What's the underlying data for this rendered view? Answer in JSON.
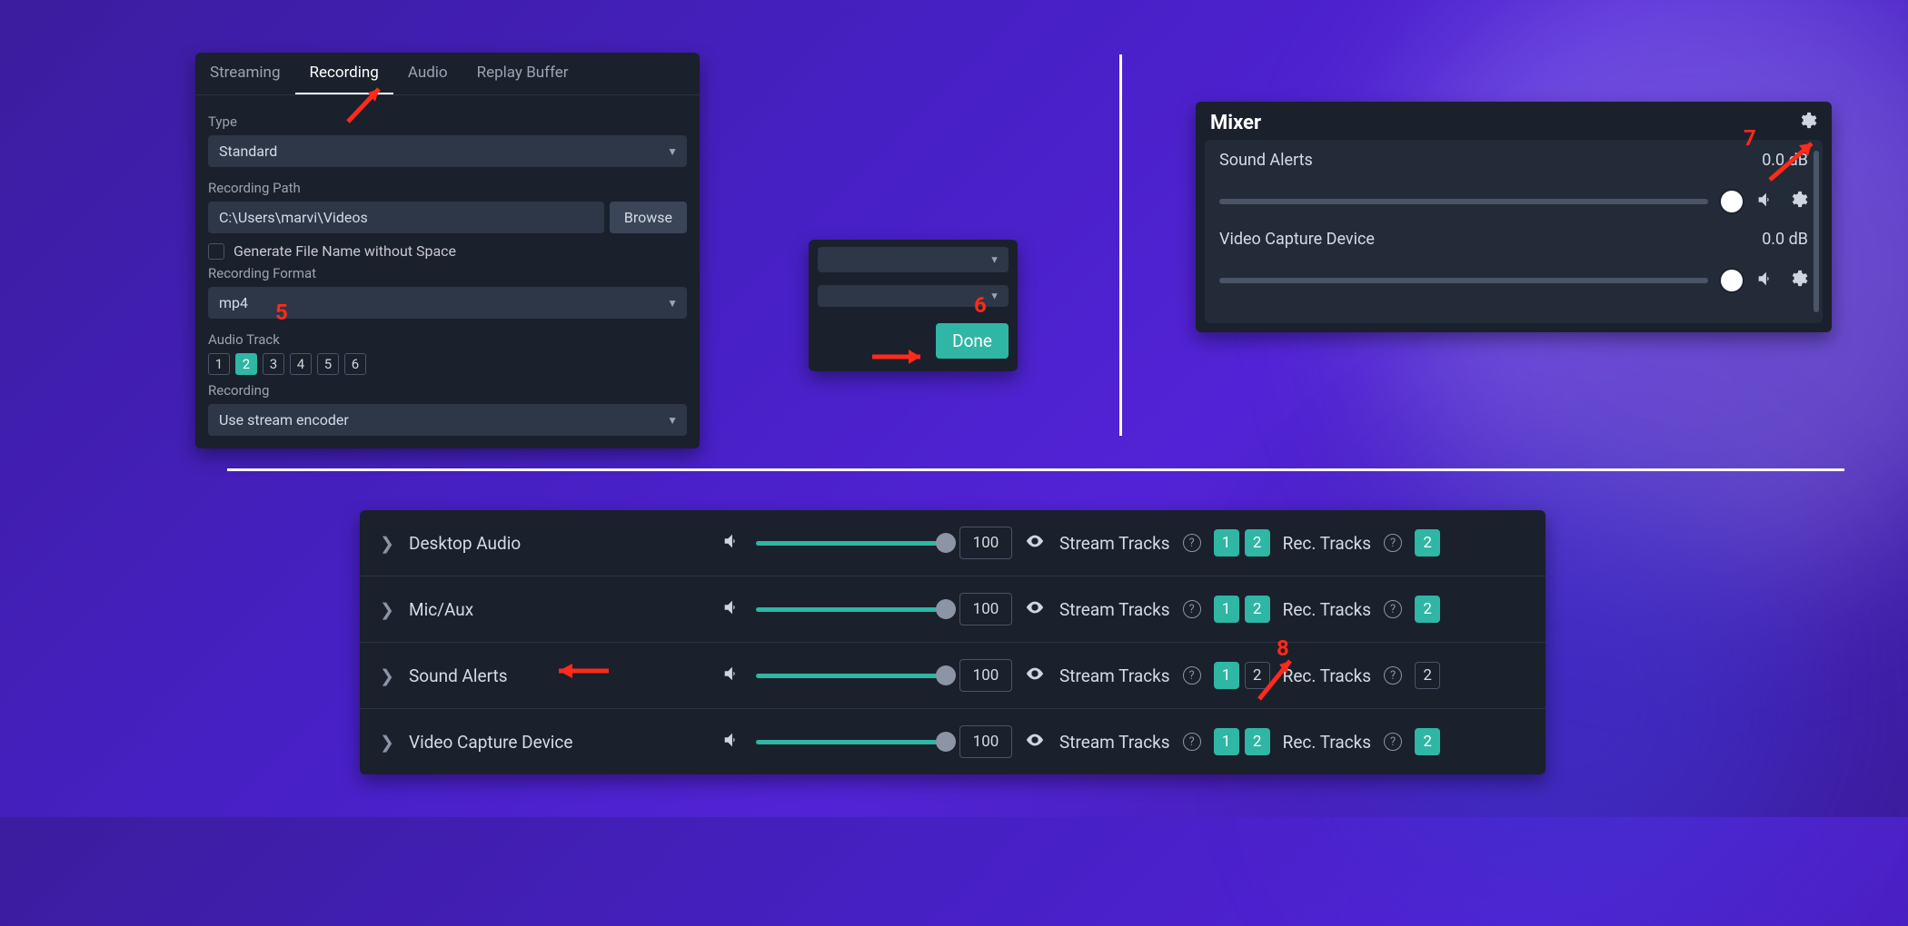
{
  "settings": {
    "tabs": [
      "Streaming",
      "Recording",
      "Audio",
      "Replay Buffer"
    ],
    "active_tab": "Recording",
    "type_label": "Type",
    "type_value": "Standard",
    "path_label": "Recording Path",
    "path_value": "C:\\Users\\marvi\\Videos",
    "browse": "Browse",
    "gen_label": "Generate File Name without Space",
    "gen_checked": false,
    "format_label": "Recording Format",
    "format_value": "mp4",
    "track_label": "Audio Track",
    "tracks": [
      {
        "n": "1",
        "on": false
      },
      {
        "n": "2",
        "on": true
      },
      {
        "n": "3",
        "on": false
      },
      {
        "n": "4",
        "on": false
      },
      {
        "n": "5",
        "on": false
      },
      {
        "n": "6",
        "on": false
      }
    ],
    "recording_label": "Recording",
    "recording_value": "Use stream encoder"
  },
  "done_button": "Done",
  "mixer": {
    "title": "Mixer",
    "sources": [
      {
        "name": "Sound Alerts",
        "db": "0.0 dB"
      },
      {
        "name": "Video Capture Device",
        "db": "0.0 dB"
      }
    ]
  },
  "adv_audio": {
    "stream_label": "Stream Tracks",
    "rec_label": "Rec. Tracks",
    "rows": [
      {
        "name": "Desktop Audio",
        "vol": "100",
        "stream": [
          {
            "n": "1",
            "on": true
          },
          {
            "n": "2",
            "on": true
          }
        ],
        "rec": [
          {
            "n": "2",
            "on": true
          }
        ]
      },
      {
        "name": "Mic/Aux",
        "vol": "100",
        "stream": [
          {
            "n": "1",
            "on": true
          },
          {
            "n": "2",
            "on": true
          }
        ],
        "rec": [
          {
            "n": "2",
            "on": true
          }
        ]
      },
      {
        "name": "Sound Alerts",
        "vol": "100",
        "stream": [
          {
            "n": "1",
            "on": true
          },
          {
            "n": "2",
            "on": false
          }
        ],
        "rec": [
          {
            "n": "2",
            "on": false
          }
        ]
      },
      {
        "name": "Video Capture Device",
        "vol": "100",
        "stream": [
          {
            "n": "1",
            "on": true
          },
          {
            "n": "2",
            "on": true
          }
        ],
        "rec": [
          {
            "n": "2",
            "on": true
          }
        ]
      }
    ]
  },
  "annotations": {
    "a5": "5",
    "a6": "6",
    "a7": "7",
    "a8": "8"
  }
}
